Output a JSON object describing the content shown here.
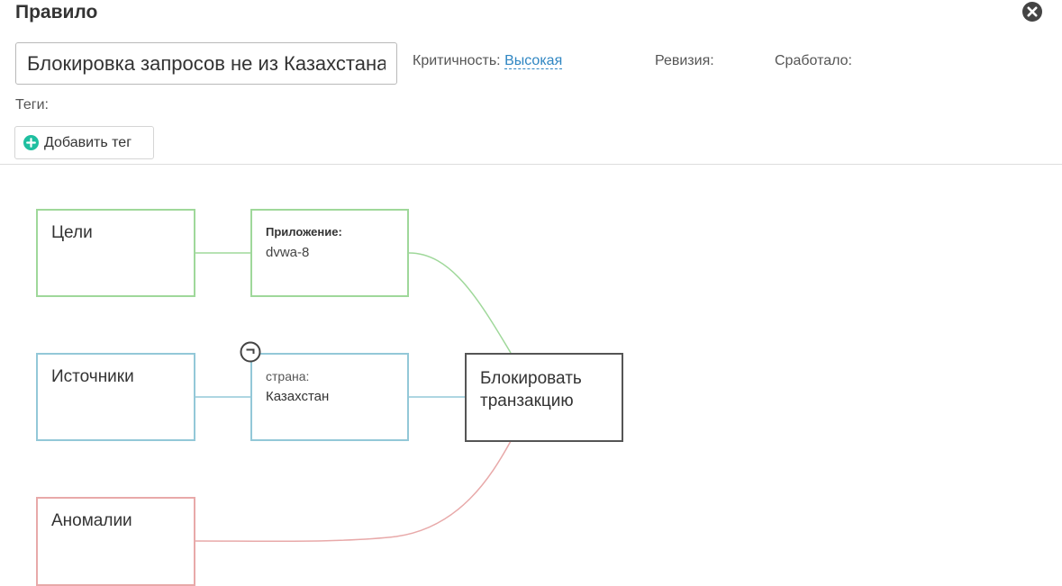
{
  "header": {
    "title": "Правило",
    "close_icon": "close-circle-icon"
  },
  "rule": {
    "name_value": "Блокировка запросов не из Казахстана",
    "severity_label": "Критичность:",
    "severity_value": "Высокая",
    "revision_label": "Ревизия:",
    "triggered_label": "Сработало:",
    "tags_label": "Теги:",
    "add_tag_label": "Добавить тег",
    "add_tag_icon": "plus-circle-icon"
  },
  "diagram": {
    "targets": {
      "title": "Цели",
      "condition_label": "Приложение:",
      "condition_value": "dvwa-8",
      "color": "#9fd89a"
    },
    "sources": {
      "title": "Источники",
      "condition_label": "страна:",
      "condition_value": "Казахстан",
      "negation_icon": "negation-icon",
      "color": "#93c8d8"
    },
    "anomalies": {
      "title": "Аномалии",
      "color": "#e8a9a9"
    },
    "action": {
      "line1": "Блокировать",
      "line2": "транзакцию"
    }
  },
  "colors": {
    "accent_link": "#2f86c2",
    "add_icon": "#1fbfa0"
  }
}
